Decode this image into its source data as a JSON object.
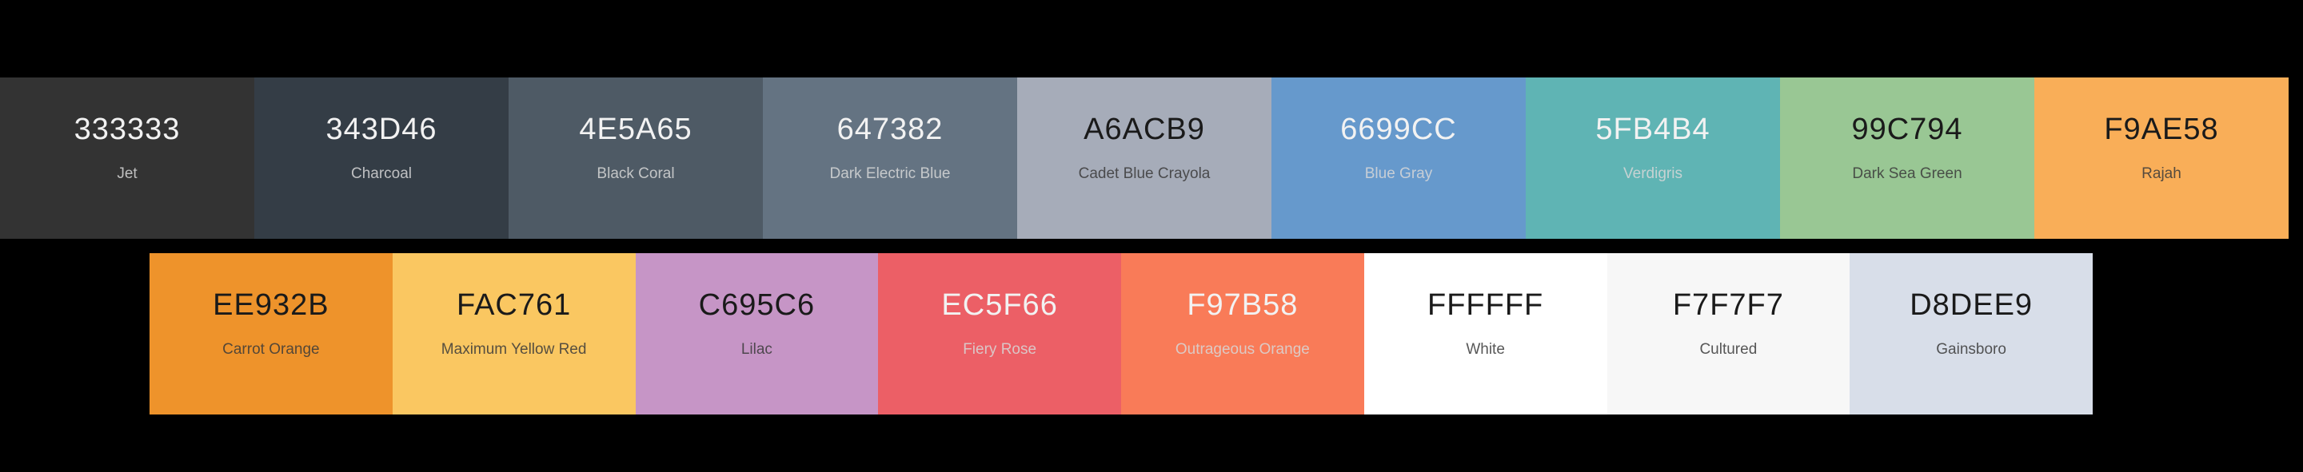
{
  "palette": {
    "row1": [
      {
        "hex": "333333",
        "name": "Jet",
        "color": "#333333",
        "text": "light"
      },
      {
        "hex": "343D46",
        "name": "Charcoal",
        "color": "#343D46",
        "text": "light"
      },
      {
        "hex": "4E5A65",
        "name": "Black Coral",
        "color": "#4E5A65",
        "text": "light"
      },
      {
        "hex": "647382",
        "name": "Dark Electric Blue",
        "color": "#647382",
        "text": "light"
      },
      {
        "hex": "A6ACB9",
        "name": "Cadet Blue Crayola",
        "color": "#A6ACB9",
        "text": "dark"
      },
      {
        "hex": "6699CC",
        "name": "Blue Gray",
        "color": "#6699CC",
        "text": "light"
      },
      {
        "hex": "5FB4B4",
        "name": "Verdigris",
        "color": "#5FB4B4",
        "text": "light"
      },
      {
        "hex": "99C794",
        "name": "Dark Sea Green",
        "color": "#99C794",
        "text": "dark"
      },
      {
        "hex": "F9AE58",
        "name": "Rajah",
        "color": "#F9AE58",
        "text": "dark"
      }
    ],
    "row2": [
      {
        "hex": "EE932B",
        "name": "Carrot Orange",
        "color": "#EE932B",
        "text": "dark"
      },
      {
        "hex": "FAC761",
        "name": "Maximum Yellow Red",
        "color": "#FAC761",
        "text": "dark"
      },
      {
        "hex": "C695C6",
        "name": "Lilac",
        "color": "#C695C6",
        "text": "dark"
      },
      {
        "hex": "EC5F66",
        "name": "Fiery Rose",
        "color": "#EC5F66",
        "text": "light"
      },
      {
        "hex": "F97B58",
        "name": "Outrageous Orange",
        "color": "#F97B58",
        "text": "light"
      },
      {
        "hex": "FFFFFF",
        "name": "White",
        "color": "#FFFFFF",
        "text": "dark"
      },
      {
        "hex": "F7F7F7",
        "name": "Cultured",
        "color": "#F7F7F7",
        "text": "dark"
      },
      {
        "hex": "D8DEE9",
        "name": "Gainsboro",
        "color": "#D8DEE9",
        "text": "dark"
      }
    ]
  }
}
